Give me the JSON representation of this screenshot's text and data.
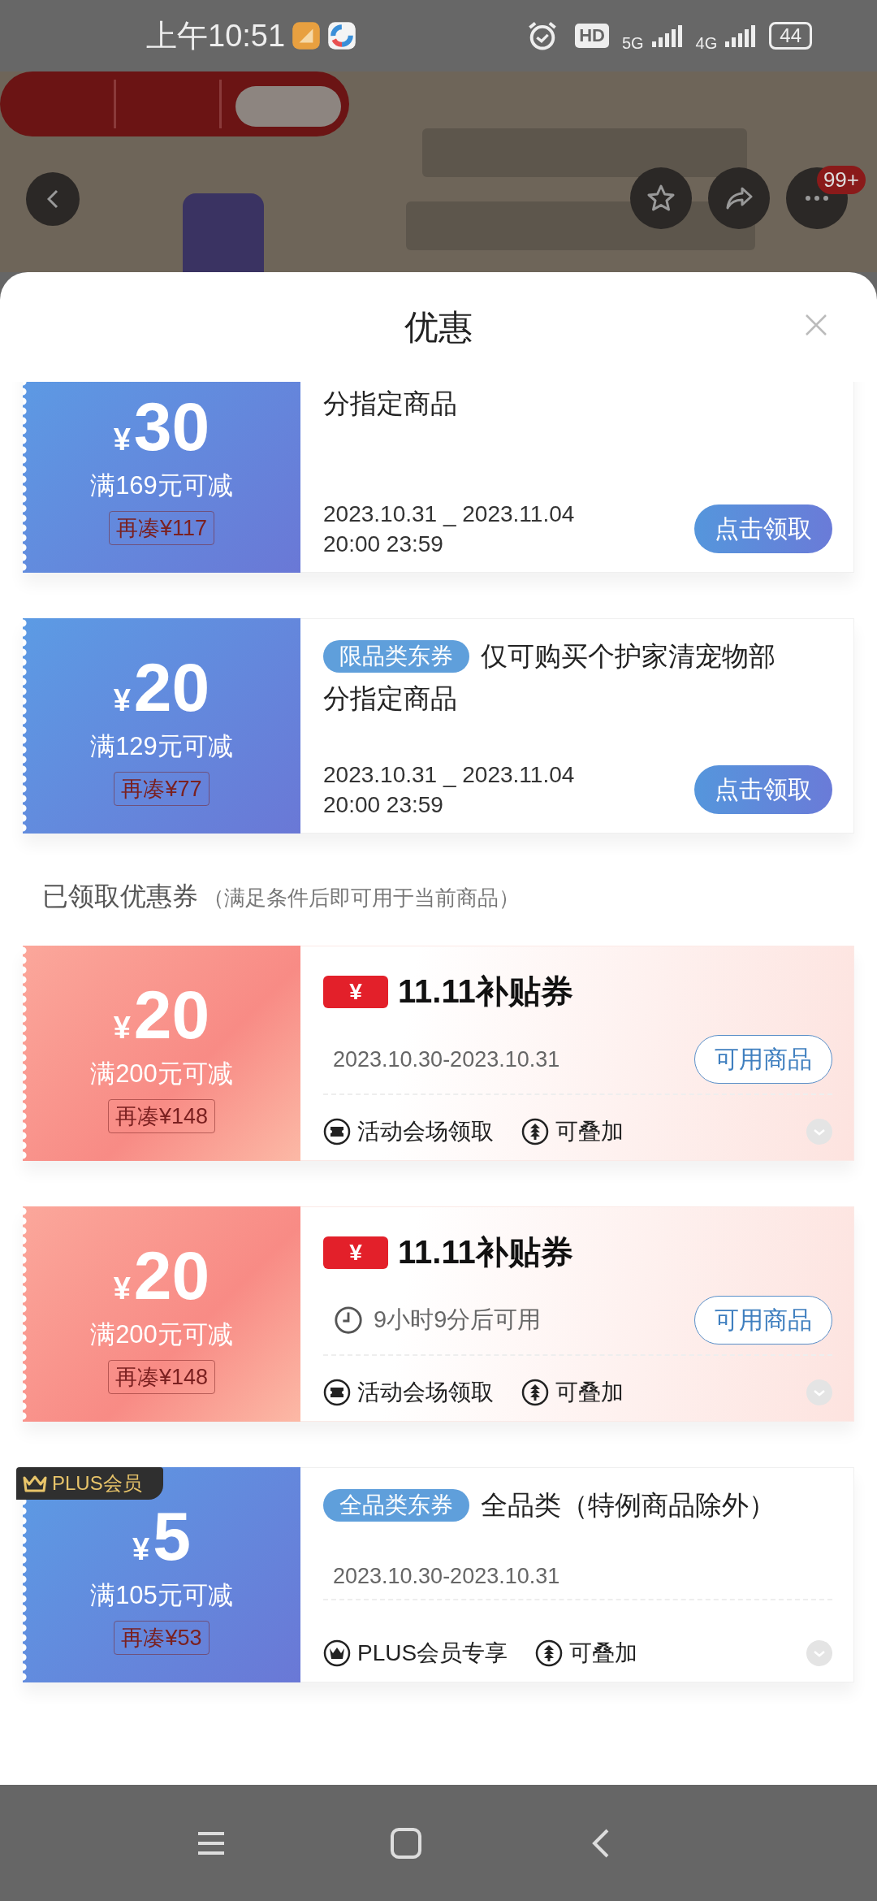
{
  "status_bar": {
    "time": "上午10:51",
    "hd": "HD",
    "net_5g": "5G",
    "net_4g": "4G",
    "battery": "44"
  },
  "top_bar": {
    "badge": "99+"
  },
  "sheet": {
    "title": "优惠"
  },
  "coupons": [
    {
      "kind": "limited",
      "currency": "¥",
      "amount": "30",
      "condition": "满169元可减",
      "gap": "再凑¥117",
      "title": [
        "分指定商品"
      ],
      "validity": [
        "2023.10.31 _ 2023.11.04",
        "20:00 23:59"
      ],
      "button": "点击领取"
    },
    {
      "kind": "limited",
      "currency": "¥",
      "amount": "20",
      "condition": "满129元可减",
      "gap": "再凑¥77",
      "tag": "限品类东券",
      "title": [
        "仅可购买个护家清宠物部",
        "分指定商品"
      ],
      "validity": [
        "2023.10.31 _ 2023.11.04",
        "20:00 23:59"
      ],
      "button": "点击领取"
    }
  ],
  "received": {
    "heading": "已领取优惠券",
    "note": "（满足条件后即可用于当前商品）",
    "coupons": [
      {
        "kind": "subsidy",
        "currency": "¥",
        "amount": "20",
        "condition": "满200元可减",
        "gap": "再凑¥148",
        "logo_mark": "¥",
        "logo_text": "11.11补贴券",
        "date": "2023.10.30-2023.10.31",
        "button": "可用商品",
        "features": [
          {
            "kind": "venue",
            "text": "活动会场领取"
          },
          {
            "kind": "stackable",
            "text": "可叠加"
          }
        ]
      },
      {
        "kind": "subsidy",
        "currency": "¥",
        "amount": "20",
        "condition": "满200元可减",
        "gap": "再凑¥148",
        "logo_mark": "¥",
        "logo_text": "11.11补贴券",
        "timer": "9小时9分后可用",
        "button": "可用商品",
        "features": [
          {
            "kind": "venue",
            "text": "活动会场领取"
          },
          {
            "kind": "stackable",
            "text": "可叠加"
          }
        ]
      },
      {
        "kind": "plus",
        "badge": "PLUS会员",
        "currency": "¥",
        "amount": "5",
        "condition": "满105元可减",
        "gap": "再凑¥53",
        "tag": "全品类东券",
        "title": [
          "全品类（特例商品除外）"
        ],
        "date": "2023.10.30-2023.10.31",
        "features": [
          {
            "kind": "member",
            "text": "PLUS会员专享"
          },
          {
            "kind": "stackable",
            "text": "可叠加"
          }
        ]
      }
    ]
  }
}
